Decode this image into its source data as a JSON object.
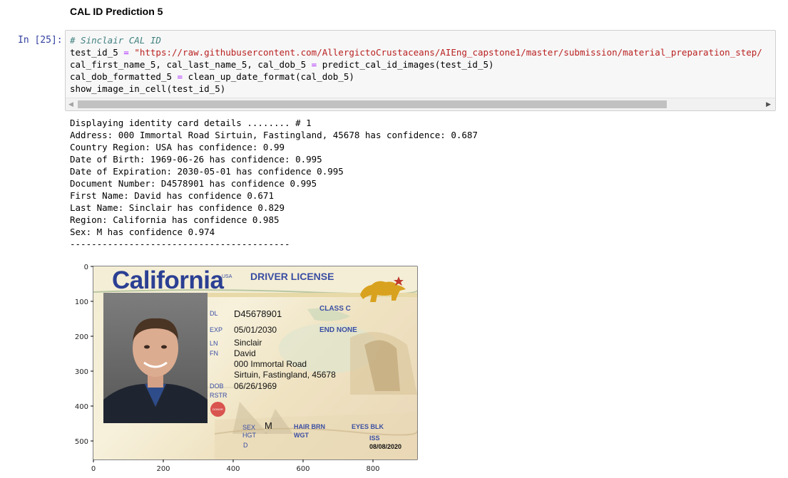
{
  "heading": "CAL ID Prediction 5",
  "cell": {
    "prompt": "In [25]:",
    "comment": "# Sinclair CAL ID",
    "line1_var": "test_id_5 ",
    "line1_op": "=",
    "line1_str": " \"https://raw.githubusercontent.com/AllergictoCrustaceans/AIEng_capstone1/master/submission/material_preparation_step/",
    "line2_a": "cal_first_name_5, cal_last_name_5, cal_dob_5 ",
    "line2_op": "=",
    "line2_b": " predict_cal_id_images(test_id_5)",
    "line3_a": "cal_dob_formatted_5 ",
    "line3_op": "=",
    "line3_b": " clean_up_date_format(cal_dob_5)",
    "line4": "show_image_in_cell(test_id_5)"
  },
  "scrollbar": {
    "left_arrow": "◀",
    "right_arrow": "▶"
  },
  "output_lines": [
    "Displaying identity card details ........ # 1",
    "Address: 000 Immortal Road Sirtuin, Fastingland, 45678 has confidence: 0.687",
    "Country Region: USA has confidence: 0.99",
    "Date of Birth: 1969-06-26 has confidence: 0.995",
    "Date of Expiration: 2030-05-01 has confidence 0.995",
    "Document Number: D4578901 has confidence 0.995",
    "First Name: David has confidence 0.671",
    "Last Name: Sinclair has confidence 0.829",
    "Region: California has confidence 0.985",
    "Sex: M has confidence 0.974",
    "-----------------------------------------"
  ],
  "plot": {
    "y_ticks": [
      "0",
      "100",
      "200",
      "300",
      "400",
      "500"
    ],
    "x_ticks": [
      "0",
      "200",
      "400",
      "600",
      "800"
    ]
  },
  "card": {
    "state": "California",
    "usa": "USA",
    "title": "DRIVER LICENSE",
    "dl_label": "DL",
    "dl_value": "D45678901",
    "class_label": "CLASS C",
    "exp_label": "EXP",
    "exp_value": "05/01/2030",
    "end_label": "END NONE",
    "ln_label": "LN",
    "ln_value": "Sinclair",
    "fn_label": "FN",
    "fn_value": "David",
    "addr1": "000 Immortal Road",
    "addr2": "Sirtuin, Fastingland, 45678",
    "dob_label": "DOB",
    "dob_value": "06/26/1969",
    "rstr_label": "RSTR",
    "donor": "DONOR",
    "sex_label": "SEX",
    "sex_value": "M",
    "hgt_label": "HGT",
    "hair_label": "HAIR BRN",
    "wgt_label": "WGT",
    "eyes_label": "EYES BLK",
    "d_label": "D",
    "iss_label": "ISS",
    "iss_value": "08/08/2020",
    "colors": {
      "title_blue": "#2b3f93",
      "field_blue": "#3a4ea3",
      "bear_gold": "#d9a21e"
    }
  }
}
